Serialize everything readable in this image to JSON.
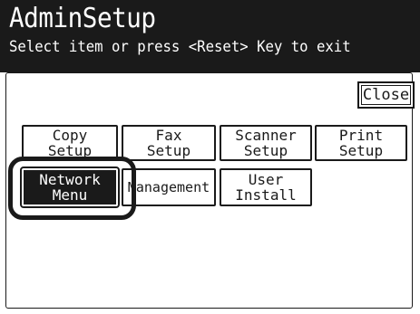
{
  "header": {
    "title": "AdminSetup",
    "subtitle": "Select item or press <Reset> Key to exit"
  },
  "close_label": "Close",
  "buttons": {
    "copy_setup": {
      "line1": "Copy",
      "line2": "Setup"
    },
    "fax_setup": {
      "line1": "Fax",
      "line2": "Setup"
    },
    "scanner_setup": {
      "line1": "Scanner",
      "line2": "Setup"
    },
    "print_setup": {
      "line1": "Print",
      "line2": "Setup"
    },
    "network_menu": {
      "line1": "Network",
      "line2": "Menu"
    },
    "management": {
      "line1": "Management"
    },
    "user_install": {
      "line1": "User",
      "line2": "Install"
    }
  },
  "colors": {
    "foreground": "#1a1a1a",
    "background": "#ffffff"
  }
}
